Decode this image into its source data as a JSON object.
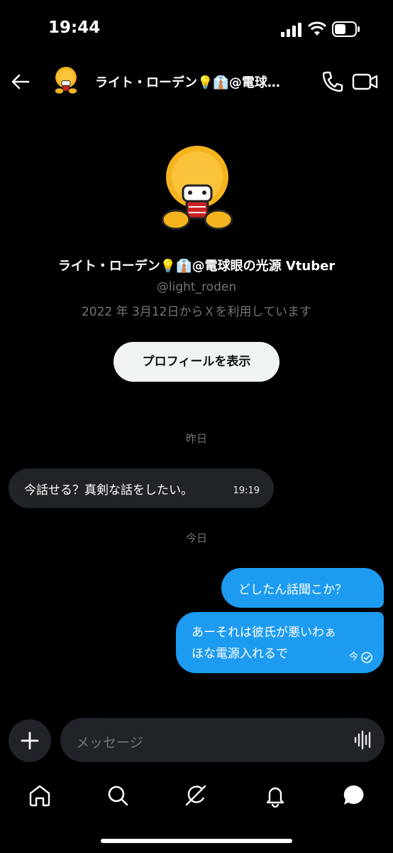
{
  "status_bar": {
    "time": "19:44"
  },
  "header": {
    "title": "ライト・ローデン💡👔@電球…"
  },
  "profile": {
    "name": "ライト・ローデン💡👔@電球眼の光源 Vtuber",
    "handle": "@light_roden",
    "joined": "2022 年 3月12日からＸを利用しています",
    "view_profile_label": "プロフィールを表示"
  },
  "messages": {
    "day1_label": "昨日",
    "incoming_text": "今話せる？真剣な話をしたい。",
    "incoming_time": "19:19",
    "day2_label": "今日",
    "outgoing1_text": "どしたん話聞こか？",
    "outgoing2_line1": "あーそれは彼氏が悪いわぁ",
    "outgoing2_line2": "ほな電源入れるで",
    "outgoing2_time": "今"
  },
  "composer": {
    "placeholder": "メッセージ"
  },
  "icons": {
    "back": "back-arrow-icon",
    "call": "phone-icon",
    "video": "video-camera-icon",
    "add": "plus-icon",
    "voice": "voice-waveform-icon",
    "home": "home-icon",
    "search": "search-icon",
    "grok": "grok-icon",
    "notifications": "bell-icon",
    "messages": "message-bubble-icon"
  },
  "colors": {
    "background": "#000000",
    "accent": "#1d9bf0",
    "bubble_incoming": "#202327",
    "muted_text": "#71767b"
  }
}
